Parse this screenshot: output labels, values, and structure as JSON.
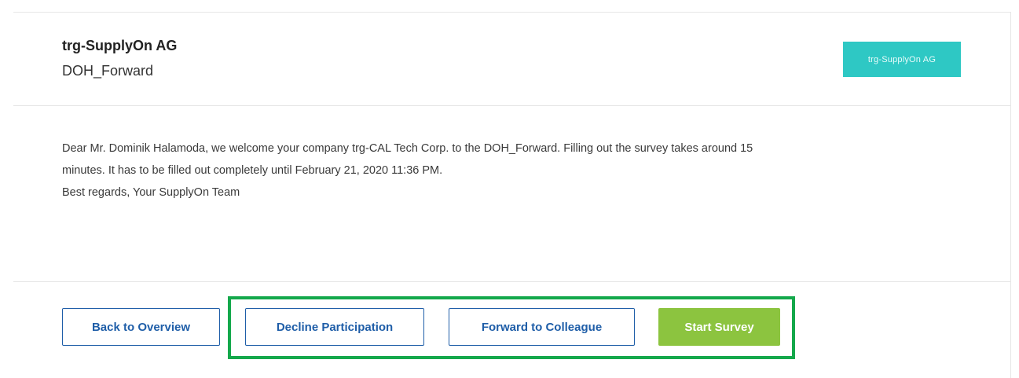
{
  "header": {
    "company_name": "trg-SupplyOn AG",
    "survey_name": "DOH_Forward",
    "logo_text": "trg-SupplyOn AG"
  },
  "message": {
    "line1": "Dear Mr. Dominik Halamoda, we welcome your company trg-CAL Tech Corp. to the DOH_Forward. Filling out the survey takes around 15",
    "line2": "minutes. It has to be filled out completely until February 21, 2020 11:36 PM.",
    "line3": "Best regards, Your SupplyOn Team"
  },
  "actions": {
    "back_label": "Back to Overview",
    "decline_label": "Decline Participation",
    "forward_label": "Forward to Colleague",
    "start_label": "Start Survey"
  },
  "colors": {
    "primary_blue": "#1f5ea8",
    "start_green": "#8cc43f",
    "logo_teal": "#2ec8c4",
    "highlight_green": "#14a84b"
  }
}
